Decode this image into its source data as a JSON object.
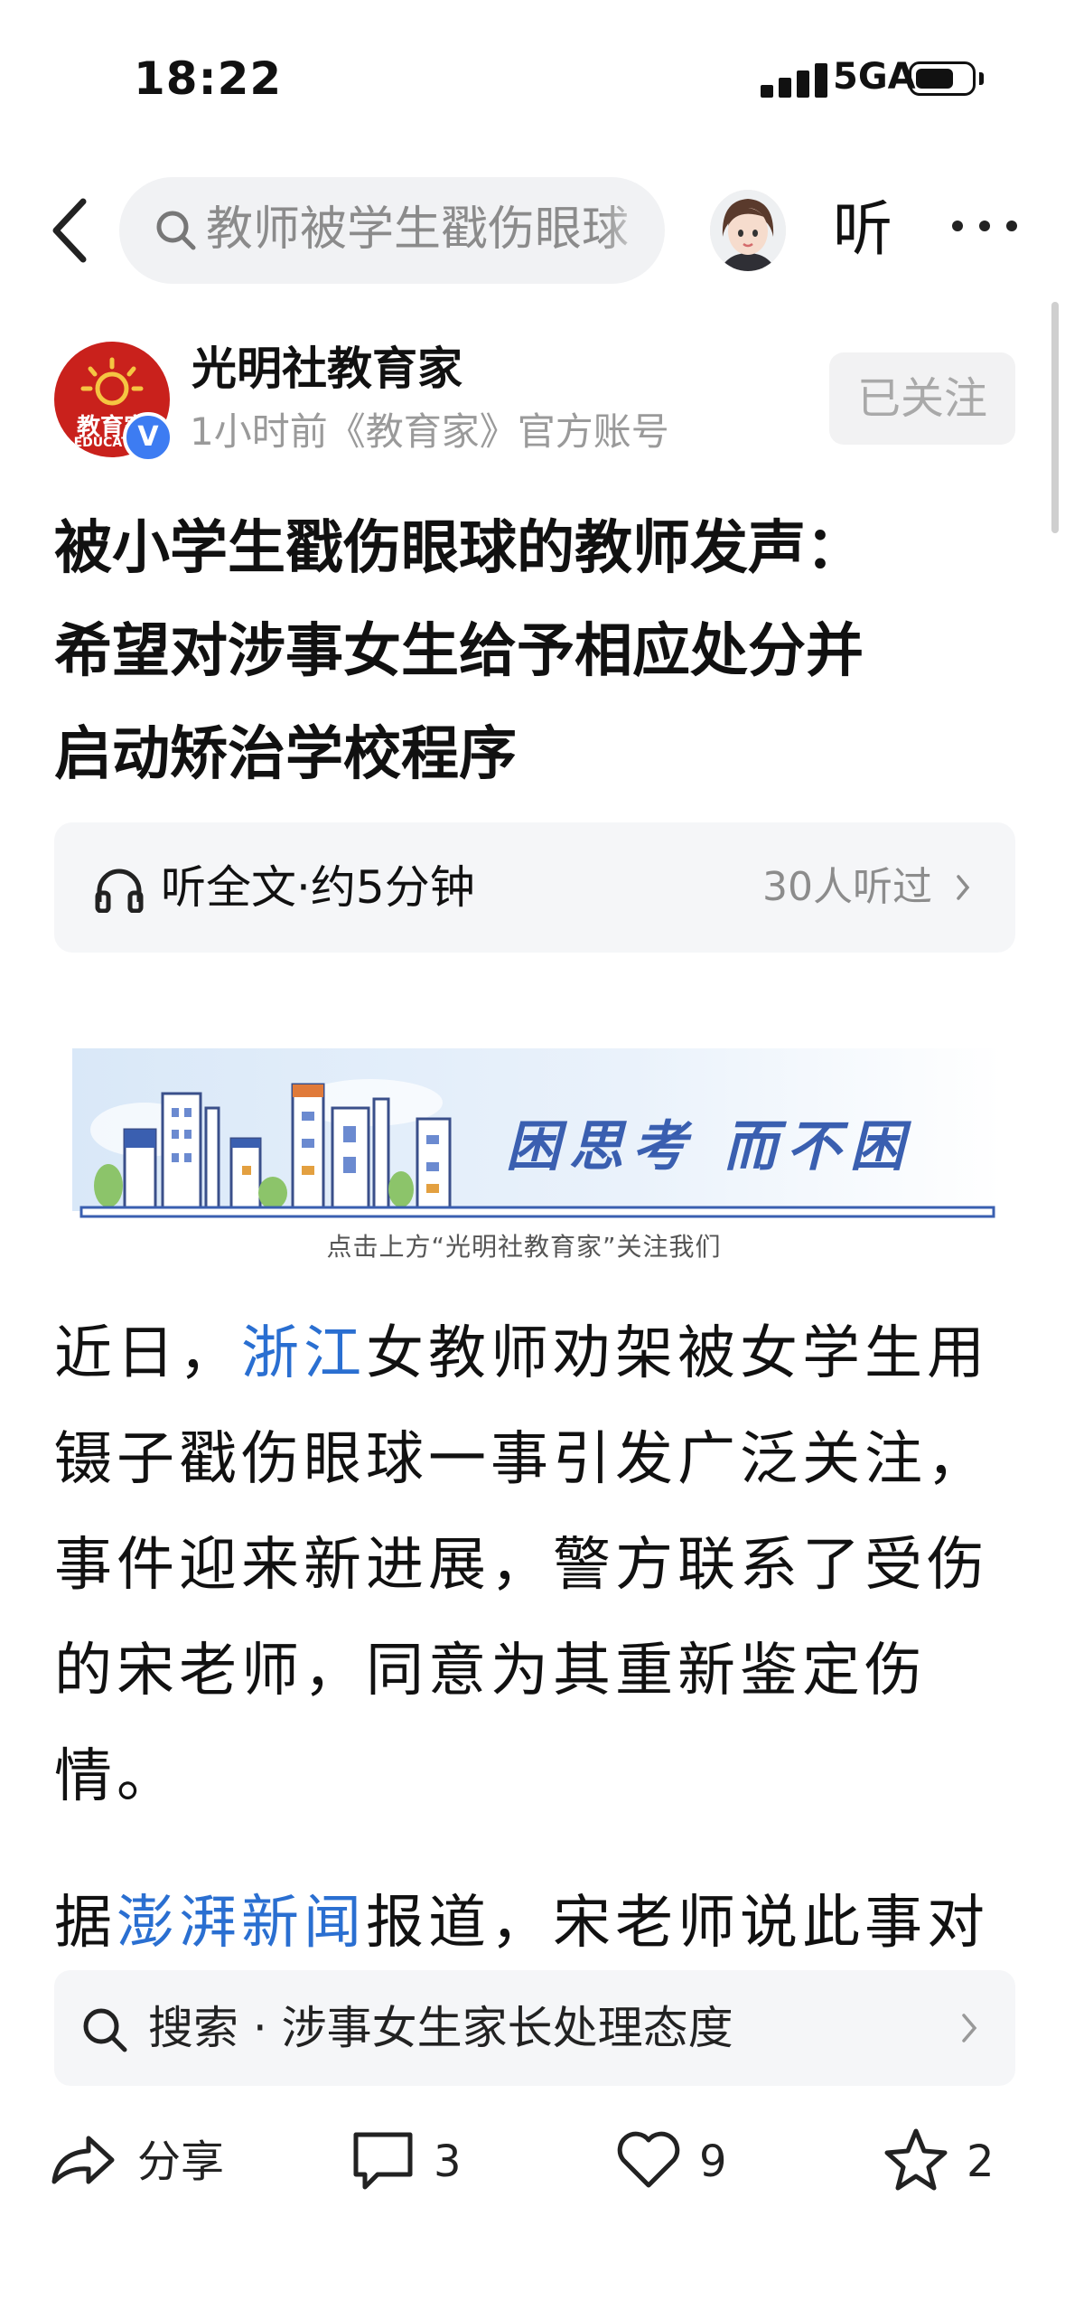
{
  "status_bar": {
    "time": "18:22",
    "network": "5GA",
    "battery_percent": 70
  },
  "nav": {
    "search_placeholder": "教师被学生戳伤眼球",
    "listen_label": "听"
  },
  "author": {
    "name": "光明社教育家",
    "meta": "1小时前《教育家》官方账号",
    "logo_text_top": "教育家",
    "logo_text_bottom": "EDUCATOR",
    "verified_mark": "V",
    "follow_label": "已关注"
  },
  "article": {
    "title_lines": [
      "被小学生戳伤眼球的教师发声：",
      "希望对涉事女生给予相应处分并",
      "启动矫治学校程序"
    ],
    "audio": {
      "label": "听全文·约5分钟",
      "listeners": "30人听过"
    },
    "banner": {
      "slogan": "困思考 而不困",
      "caption": "点击上方“光明社教育家”关注我们"
    },
    "p1": {
      "l1_a": "近日，",
      "l1_link": "浙江",
      "l1_b": "女教师劝架被女学生用",
      "l2": "镊子戳伤眼球一事引发广泛关注，",
      "l3": "事件迎来新进展，警方联系了受伤",
      "l4": "的宋老师，同意为其重新鉴定伤",
      "l5": "情。"
    },
    "p2": {
      "a": "据",
      "link": "澎湃新闻",
      "b": "报道，宋老师说此事对"
    }
  },
  "related_search": {
    "text": "搜索 · 涉事女生家长处理态度"
  },
  "toolbar": {
    "share_label": "分享",
    "comment_count": "3",
    "like_count": "9",
    "favorite_count": "2"
  }
}
